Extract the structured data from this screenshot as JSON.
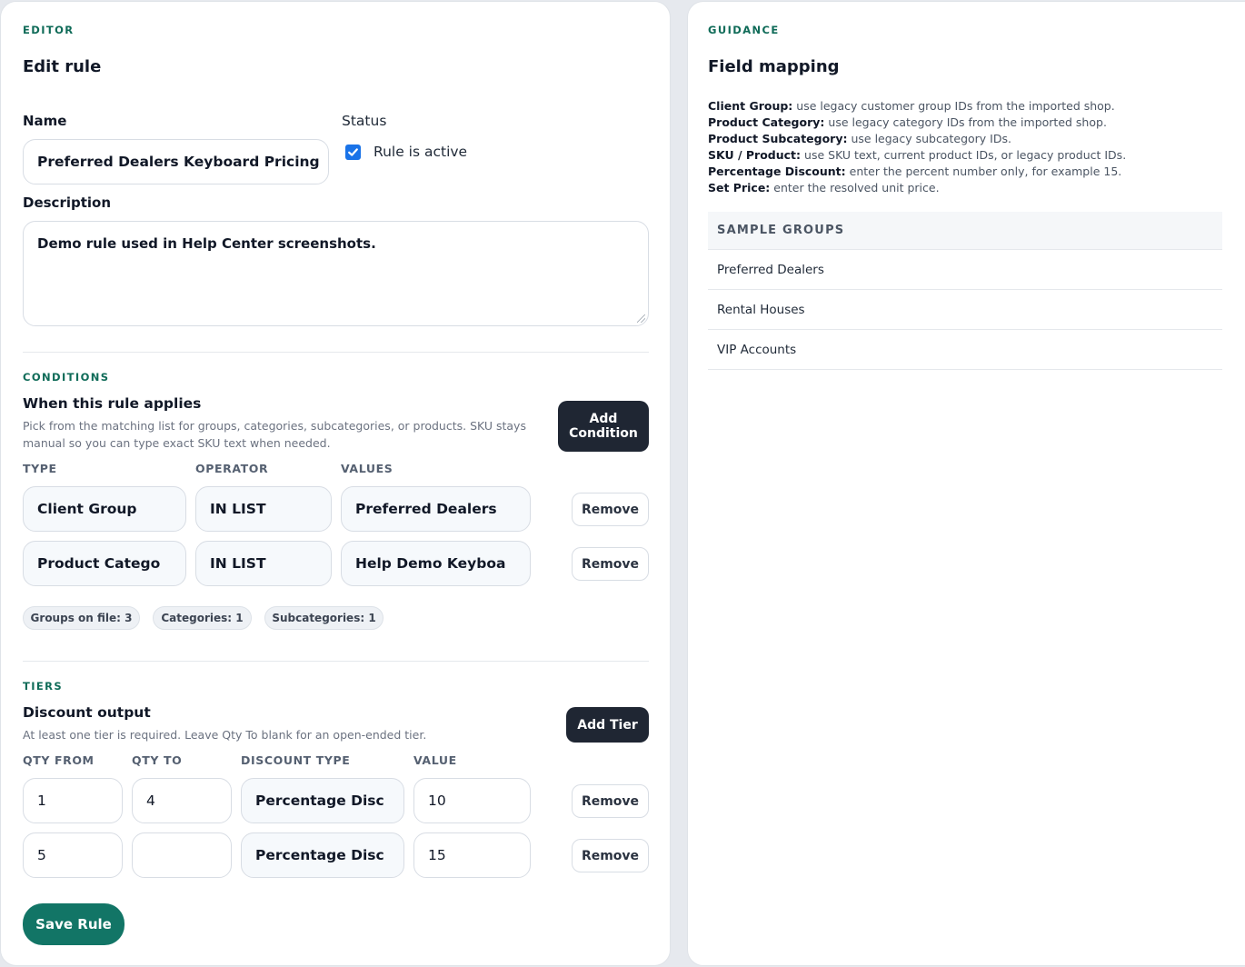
{
  "editor": {
    "eyebrow": "EDITOR",
    "title": "Edit rule",
    "name_label": "Name",
    "name_value": "Preferred Dealers Keyboard Pricing",
    "status_label": "Status",
    "active_label": "Rule is active",
    "active_checked": true,
    "description_label": "Description",
    "description_value": "Demo rule used in Help Center screenshots.",
    "save_label": "Save Rule"
  },
  "conditions": {
    "eyebrow": "CONDITIONS",
    "title": "When this rule applies",
    "help": "Pick from the matching list for groups, categories, subcategories, or products. SKU stays manual so you can type exact SKU text when needed.",
    "add_label": "Add Condition",
    "headers": {
      "type": "TYPE",
      "operator": "OPERATOR",
      "values": "VALUES"
    },
    "rows": [
      {
        "type": "Client Group",
        "operator": "IN LIST",
        "values": "Preferred Dealers",
        "remove": "Remove"
      },
      {
        "type": "Product Catego",
        "operator": "IN LIST",
        "values": "Help Demo Keyboa",
        "remove": "Remove"
      }
    ],
    "pills": [
      "Groups on file: 3",
      "Categories: 1",
      "Subcategories: 1"
    ]
  },
  "tiers": {
    "eyebrow": "TIERS",
    "title": "Discount output",
    "help": "At least one tier is required. Leave Qty To blank for an open-ended tier.",
    "add_label": "Add Tier",
    "headers": {
      "qty_from": "QTY FROM",
      "qty_to": "QTY TO",
      "discount_type": "DISCOUNT TYPE",
      "value": "VALUE"
    },
    "rows": [
      {
        "qty_from": "1",
        "qty_to": "4",
        "discount_type": "Percentage Disc",
        "value": "10",
        "remove": "Remove"
      },
      {
        "qty_from": "5",
        "qty_to": "",
        "discount_type": "Percentage Disc",
        "value": "15",
        "remove": "Remove"
      }
    ]
  },
  "guidance": {
    "eyebrow": "GUIDANCE",
    "title": "Field mapping",
    "mappings": [
      {
        "term": "Client Group:",
        "text": "use legacy customer group IDs from the imported shop."
      },
      {
        "term": "Product Category:",
        "text": "use legacy category IDs from the imported shop."
      },
      {
        "term": "Product Subcategory:",
        "text": "use legacy subcategory IDs."
      },
      {
        "term": "SKU / Product:",
        "text": "use SKU text, current product IDs, or legacy product IDs."
      },
      {
        "term": "Percentage Discount:",
        "text": "enter the percent number only, for example 15."
      },
      {
        "term": "Set Price:",
        "text": "enter the resolved unit price."
      }
    ],
    "sample_header": "SAMPLE GROUPS",
    "sample_groups": [
      "Preferred Dealers",
      "Rental Houses",
      "VIP Accounts"
    ]
  },
  "colors": {
    "accent_green": "#127566",
    "eyebrow_green": "#0f6b58",
    "dark_button": "#1f2633",
    "checkbox_blue": "#1a73e8"
  }
}
